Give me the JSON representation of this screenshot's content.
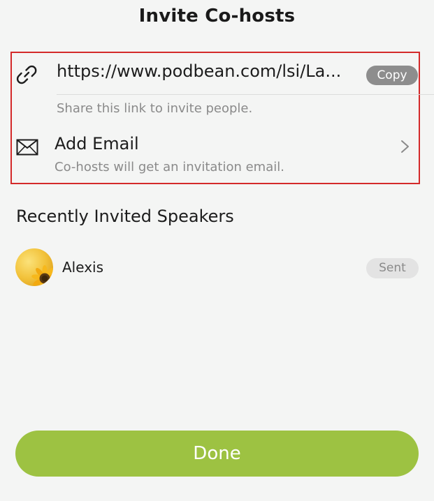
{
  "header": {
    "title": "Invite Co-hosts"
  },
  "share_link": {
    "url": "https://www.podbean.com/lsi/La...",
    "copy_label": "Copy",
    "hint": "Share this link to invite people.",
    "icon": "link-icon"
  },
  "add_email": {
    "title": "Add Email",
    "hint": "Co-hosts will get an invitation email.",
    "icon": "mail-icon"
  },
  "recent": {
    "title": "Recently Invited Speakers",
    "speakers": [
      {
        "name": "Alexis",
        "status": "Sent",
        "avatar": "sunflower-avatar"
      }
    ]
  },
  "footer": {
    "done_label": "Done"
  },
  "colors": {
    "accent": "#9dc242",
    "highlight_border": "#d42a2a",
    "copy_button": "#8d8d8d",
    "badge_bg": "#e3e3e3",
    "background": "#f4f5f4"
  }
}
